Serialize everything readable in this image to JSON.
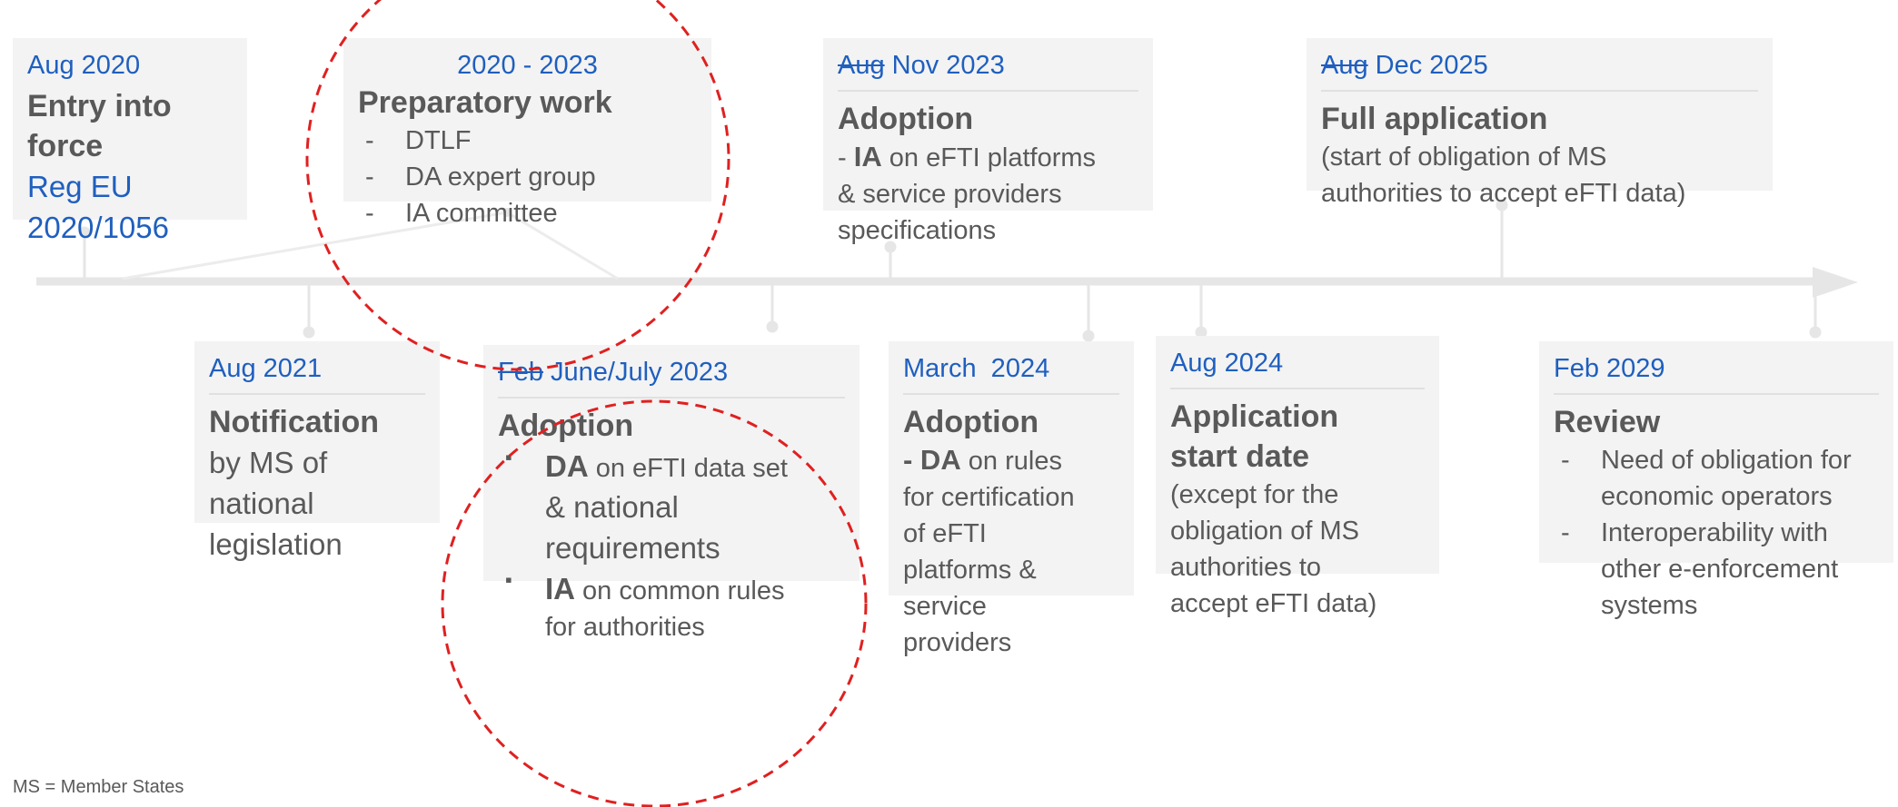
{
  "events": {
    "entry": {
      "date": "Aug 2020",
      "title_line1": "Entry into",
      "title_line2": "force",
      "ref_line1": "Reg EU",
      "ref_line2": "2020/1056"
    },
    "prep": {
      "date": "2020 - 2023",
      "title": "Preparatory work",
      "items": [
        "DTLF",
        "DA expert group",
        "IA committee"
      ]
    },
    "adoption_ia": {
      "date_struck": "Aug",
      "date_new": "Nov 2023",
      "title": "Adoption",
      "line1_prefix": "- ",
      "line1_bold": "IA",
      "line1_rest": " on eFTI platforms",
      "line2": "& service providers",
      "line3": "specifications"
    },
    "full_app": {
      "date_struck": "Aug",
      "date_new": "Dec 2025",
      "title": "Full application",
      "line1": "(start of obligation of MS",
      "line2": "authorities to accept eFTI data)"
    },
    "notification": {
      "date": "Aug 2021",
      "title": "Notification",
      "line1": "by MS of",
      "line2": "national",
      "line3": "legislation"
    },
    "adoption_da": {
      "date_struck": "Feb",
      "date_new": "June/July 2023",
      "title": "Adoption",
      "item1_bold": "DA",
      "item1_rest": " on eFTI data set",
      "item1_line2": "& national",
      "item1_line3": "requirements",
      "item2_bold": "IA",
      "item2_rest": " on common rules",
      "item2_line2": "for authorities"
    },
    "adoption_cert": {
      "date": "March  2024",
      "title": "Adoption",
      "line1_bold": "- DA",
      "line1_rest": " on rules",
      "line2": "for certification",
      "line3": "of eFTI",
      "line4": "platforms &",
      "line5": "service",
      "line6": "providers"
    },
    "application_start": {
      "date": "Aug 2024",
      "title_line1": "Application",
      "title_line2": "start date",
      "line1": "(except for the",
      "line2": "obligation of MS",
      "line3": "authorities to",
      "line4": "accept eFTI data)"
    },
    "review": {
      "date": "Feb 2029",
      "title": "Review",
      "item1_line1": "Need of obligation for",
      "item1_line2": "economic operators",
      "item2_line1": "Interoperability with",
      "item2_line2": "other e-enforcement",
      "item2_line3": "systems"
    }
  },
  "footnotes": {
    "ms": "MS = Member States"
  },
  "colors": {
    "date_blue": "#1f5fbf",
    "text_gray": "#595959",
    "card_bg": "#f3f3f3",
    "timeline": "#e6e6e6",
    "highlight_red": "#e02020"
  }
}
